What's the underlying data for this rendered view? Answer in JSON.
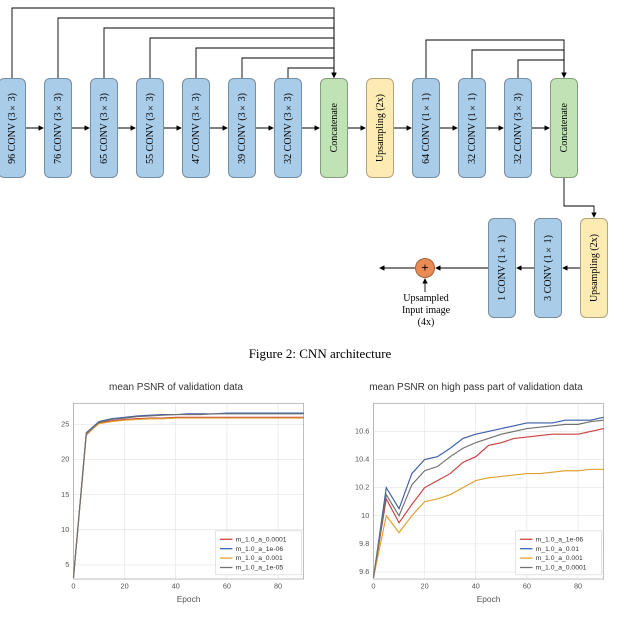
{
  "diagram": {
    "row1": [
      {
        "label": "96 CONV (3×3)",
        "cls": "blue"
      },
      {
        "label": "76 CONV (3×3)",
        "cls": "blue"
      },
      {
        "label": "65 CONV (3×3)",
        "cls": "blue"
      },
      {
        "label": "55 CONV (3×3)",
        "cls": "blue"
      },
      {
        "label": "47 CONV (3×3)",
        "cls": "blue"
      },
      {
        "label": "39 CONV (3×3)",
        "cls": "blue"
      },
      {
        "label": "32 CONV (3×3)",
        "cls": "blue"
      },
      {
        "label": "Concatenate",
        "cls": "green"
      },
      {
        "label": "Upsampling (2x)",
        "cls": "yellow"
      },
      {
        "label": "64 CONV (1×1)",
        "cls": "blue"
      },
      {
        "label": "32 CONV (1×1)",
        "cls": "blue"
      },
      {
        "label": "32 CONV (3×3)",
        "cls": "blue"
      },
      {
        "label": "Concatenate",
        "cls": "green"
      }
    ],
    "row2": [
      {
        "label": "Upsampling (2x)",
        "cls": "yellow"
      },
      {
        "label": "3 CONV (1×1)",
        "cls": "blue"
      },
      {
        "label": "1 CONV (1×1)",
        "cls": "blue"
      }
    ],
    "plus_label": "Upsampled\nInput image\n(4x)",
    "caption": "Figure 2: CNN architecture"
  },
  "chart_data": [
    {
      "type": "line",
      "title": "mean PSNR of validation data",
      "xlabel": "Epoch",
      "ylabel": "",
      "xlim": [
        0,
        90
      ],
      "ylim": [
        3,
        28
      ],
      "xticks": [
        0,
        20,
        40,
        60,
        80
      ],
      "yticks": [
        5,
        10,
        15,
        20,
        25
      ],
      "x": [
        0,
        5,
        10,
        15,
        20,
        25,
        30,
        35,
        40,
        45,
        50,
        55,
        60,
        65,
        70,
        75,
        80,
        85,
        90
      ],
      "series": [
        {
          "name": "m_1.0_a_0.0001",
          "color": "#c94040",
          "values": [
            3.2,
            23.5,
            25.2,
            25.5,
            25.7,
            25.8,
            25.9,
            25.9,
            26.0,
            26.0,
            26.0,
            26.0,
            26.0,
            26.0,
            26.0,
            26.0,
            26.0,
            26.0,
            26.0
          ]
        },
        {
          "name": "m_1.0_a_1e-06",
          "color": "#3b5fa8",
          "values": [
            3.2,
            23.8,
            25.4,
            25.8,
            26.0,
            26.2,
            26.3,
            26.4,
            26.4,
            26.5,
            26.5,
            26.5,
            26.6,
            26.6,
            26.6,
            26.6,
            26.6,
            26.6,
            26.6
          ]
        },
        {
          "name": "m_1.0_a_0.001",
          "color": "#e0a030",
          "values": [
            3.2,
            23.6,
            25.1,
            25.4,
            25.6,
            25.7,
            25.8,
            25.8,
            25.9,
            25.9,
            25.9,
            25.9,
            25.9,
            25.9,
            25.9,
            25.9,
            25.9,
            25.9,
            25.9
          ]
        },
        {
          "name": "m_1.0_a_1e-05",
          "color": "#707070",
          "values": [
            3.2,
            23.7,
            25.3,
            25.7,
            25.9,
            26.1,
            26.2,
            26.3,
            26.4,
            26.4,
            26.4,
            26.5,
            26.5,
            26.5,
            26.5,
            26.5,
            26.5,
            26.5,
            26.5
          ]
        }
      ],
      "legend_pos": "bottom-right"
    },
    {
      "type": "line",
      "title": "mean PSNR on high pass part of validation data",
      "xlabel": "Epoch",
      "ylabel": "",
      "xlim": [
        0,
        90
      ],
      "ylim": [
        9.55,
        10.8
      ],
      "xticks": [
        0,
        20,
        40,
        60,
        80
      ],
      "yticks": [
        9.6,
        9.8,
        10.0,
        10.2,
        10.4,
        10.6
      ],
      "x": [
        0,
        5,
        10,
        15,
        20,
        25,
        30,
        35,
        40,
        45,
        50,
        55,
        60,
        65,
        70,
        75,
        80,
        85,
        90
      ],
      "series": [
        {
          "name": "m_1.0_a_1e-06",
          "color": "#c94040",
          "values": [
            9.56,
            10.12,
            9.95,
            10.08,
            10.2,
            10.25,
            10.3,
            10.38,
            10.42,
            10.5,
            10.52,
            10.55,
            10.56,
            10.57,
            10.58,
            10.58,
            10.58,
            10.6,
            10.62
          ]
        },
        {
          "name": "m_1.0_a_0.01",
          "color": "#3b5fa8",
          "values": [
            9.56,
            10.2,
            10.05,
            10.3,
            10.4,
            10.42,
            10.48,
            10.55,
            10.58,
            10.6,
            10.62,
            10.64,
            10.66,
            10.66,
            10.66,
            10.68,
            10.68,
            10.68,
            10.7
          ]
        },
        {
          "name": "m_1.0_a_0.001",
          "color": "#e0a030",
          "values": [
            9.56,
            10.0,
            9.88,
            10.0,
            10.1,
            10.12,
            10.15,
            10.2,
            10.25,
            10.27,
            10.28,
            10.29,
            10.3,
            10.3,
            10.31,
            10.32,
            10.32,
            10.33,
            10.33
          ]
        },
        {
          "name": "m_1.0_a_0.0001",
          "color": "#707070",
          "values": [
            9.56,
            10.15,
            10.0,
            10.22,
            10.32,
            10.35,
            10.42,
            10.48,
            10.52,
            10.55,
            10.58,
            10.6,
            10.62,
            10.63,
            10.64,
            10.65,
            10.65,
            10.67,
            10.68
          ]
        }
      ],
      "legend_pos": "bottom-right"
    }
  ]
}
